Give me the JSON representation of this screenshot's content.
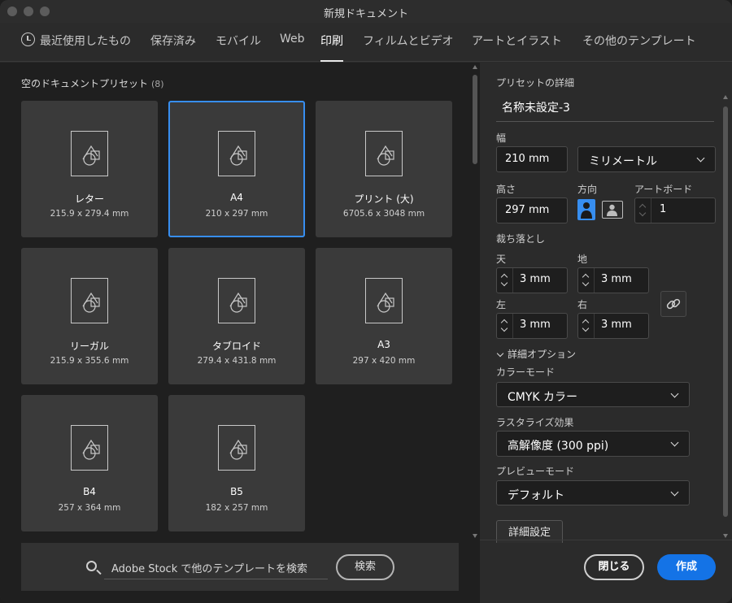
{
  "window": {
    "title": "新規ドキュメント"
  },
  "tabs": [
    {
      "label": "最近使用したもの",
      "icon": "clock-icon"
    },
    {
      "label": "保存済み"
    },
    {
      "label": "モバイル"
    },
    {
      "label": "Web"
    },
    {
      "label": "印刷",
      "active": true
    },
    {
      "label": "フィルムとビデオ"
    },
    {
      "label": "アートとイラスト"
    },
    {
      "label": "その他のテンプレート"
    }
  ],
  "presets": {
    "title": "空のドキュメントプリセット",
    "count": "(8)",
    "items": [
      {
        "name": "レター",
        "size": "215.9 x 279.4 mm"
      },
      {
        "name": "A4",
        "size": "210 x 297 mm",
        "selected": true
      },
      {
        "name": "プリント (大)",
        "size": "6705.6 x 3048 mm"
      },
      {
        "name": "リーガル",
        "size": "215.9 x 355.6 mm"
      },
      {
        "name": "タブロイド",
        "size": "279.4 x 431.8 mm"
      },
      {
        "name": "A3",
        "size": "297 x 420 mm"
      },
      {
        "name": "B4",
        "size": "257 x 364 mm"
      },
      {
        "name": "B5",
        "size": "182 x 257 mm"
      }
    ]
  },
  "stock": {
    "placeholder": "Adobe Stock で他のテンプレートを検索",
    "search_label": "検索"
  },
  "details": {
    "header": "プリセットの詳細",
    "name": "名称未設定-3",
    "width_label": "幅",
    "width_value": "210 mm",
    "unit": "ミリメートル",
    "height_label": "高さ",
    "height_value": "297 mm",
    "orientation_label": "方向",
    "artboard_label": "アートボード",
    "artboard_value": "1",
    "bleed_label": "裁ち落とし",
    "bleed_top_label": "天",
    "bleed_top": "3 mm",
    "bleed_bottom_label": "地",
    "bleed_bottom": "3 mm",
    "bleed_left_label": "左",
    "bleed_left": "3 mm",
    "bleed_right_label": "右",
    "bleed_right": "3 mm",
    "advanced_label": "詳細オプション",
    "color_mode_label": "カラーモード",
    "color_mode": "CMYK カラー",
    "raster_label": "ラスタライズ効果",
    "raster": "高解像度 (300 ppi)",
    "preview_label": "プレビューモード",
    "preview": "デフォルト",
    "more_settings": "詳細設定"
  },
  "footer": {
    "close_label": "閉じる",
    "create_label": "作成"
  },
  "colors": {
    "accent": "#1473e6",
    "selected_border": "#378ef0"
  }
}
